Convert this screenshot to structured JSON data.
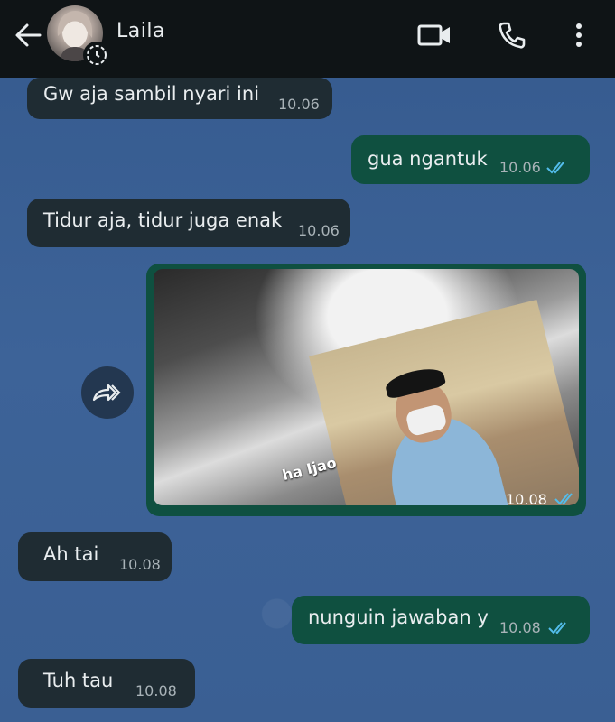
{
  "header": {
    "contact_name": "Laila",
    "background": "#0f1416"
  },
  "messages": [
    {
      "direction": "in",
      "text": "Gw aja sambil nyari ini",
      "time": "10.06"
    },
    {
      "direction": "out",
      "text": "gua ngantuk",
      "time": "10.06",
      "status": "read"
    },
    {
      "direction": "in",
      "text": "Tidur aja, tidur juga enak",
      "time": "10.06"
    },
    {
      "direction": "out",
      "type": "image",
      "overlay_text": "ha Ijao",
      "time": "10.08",
      "status": "read"
    },
    {
      "direction": "in",
      "text": "Ah tai",
      "time": "10.08"
    },
    {
      "direction": "out",
      "text": "nunguin jawaban y",
      "time": "10.08",
      "status": "read"
    },
    {
      "direction": "in",
      "text": "Tuh tau",
      "time": "10.08"
    }
  ],
  "colors": {
    "incoming_bubble": "#1f2c33",
    "outgoing_bubble": "#0f5040",
    "read_ticks": "#53bdeb",
    "chat_background": "#3b5f94"
  },
  "icons": {
    "back": "arrow-left-icon",
    "video": "video-call-icon",
    "call": "phone-icon",
    "menu": "kebab-menu-icon",
    "forward": "forward-icon"
  }
}
